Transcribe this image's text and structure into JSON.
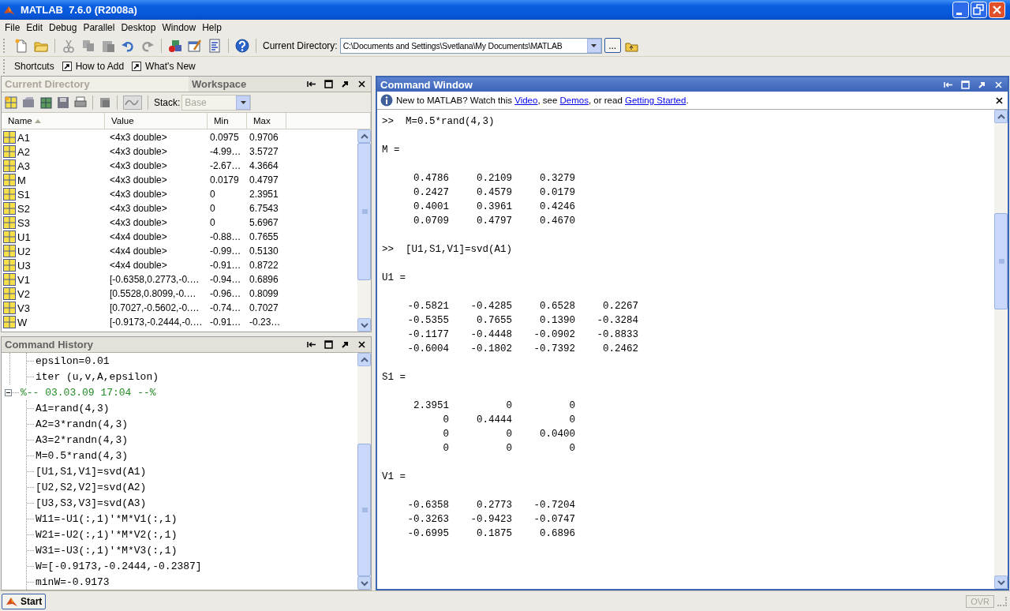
{
  "window": {
    "title": "MATLAB  7.6.0 (R2008a)"
  },
  "menu": [
    "File",
    "Edit",
    "Debug",
    "Parallel",
    "Desktop",
    "Window",
    "Help"
  ],
  "toolbar": {
    "directory_label": "Current Directory:",
    "directory_value": "C:\\Documents and Settings\\Svetlana\\My Documents\\MATLAB",
    "browse_button": "..."
  },
  "shortcuts": [
    {
      "label": "Shortcuts",
      "kind": "label"
    },
    {
      "label": "How to Add",
      "kind": "shortcut"
    },
    {
      "label": "What's New",
      "kind": "shortcut"
    }
  ],
  "left_tabs": [
    {
      "label": "Current Directory",
      "selected": false
    },
    {
      "label": "Workspace",
      "selected": true
    }
  ],
  "workspace": {
    "stack_label": "Stack:",
    "stack_value": "Base",
    "stack_disabled": true,
    "columns": [
      {
        "label": "Name",
        "sorted": true
      },
      {
        "label": "Value",
        "sorted": false
      },
      {
        "label": "Min",
        "sorted": false
      },
      {
        "label": "Max",
        "sorted": false
      }
    ],
    "rows": [
      {
        "name": "A1",
        "value": "<4x3 double>",
        "min": "0.0975",
        "max": "0.9706"
      },
      {
        "name": "A2",
        "value": "<4x3 double>",
        "min": "-4.99…",
        "max": "3.5727"
      },
      {
        "name": "A3",
        "value": "<4x3 double>",
        "min": "-2.67…",
        "max": "4.3664"
      },
      {
        "name": "M",
        "value": "<4x3 double>",
        "min": "0.0179",
        "max": "0.4797"
      },
      {
        "name": "S1",
        "value": "<4x3 double>",
        "min": "0",
        "max": "2.3951"
      },
      {
        "name": "S2",
        "value": "<4x3 double>",
        "min": "0",
        "max": "6.7543"
      },
      {
        "name": "S3",
        "value": "<4x3 double>",
        "min": "0",
        "max": "5.6967"
      },
      {
        "name": "U1",
        "value": "<4x4 double>",
        "min": "-0.88…",
        "max": "0.7655"
      },
      {
        "name": "U2",
        "value": "<4x4 double>",
        "min": "-0.99…",
        "max": "0.5130"
      },
      {
        "name": "U3",
        "value": "<4x4 double>",
        "min": "-0.91…",
        "max": "0.8722"
      },
      {
        "name": "V1",
        "value": "[-0.6358,0.2773,-0.…",
        "min": "-0.94…",
        "max": "0.6896"
      },
      {
        "name": "V2",
        "value": "[0.5528,0.8099,-0.…",
        "min": "-0.96…",
        "max": "0.8099"
      },
      {
        "name": "V3",
        "value": "[0.7027,-0.5602,-0.…",
        "min": "-0.74…",
        "max": "0.7027"
      },
      {
        "name": "W",
        "value": "[-0.9173,-0.2444,-0.…",
        "min": "-0.91…",
        "max": "-0.23…"
      }
    ]
  },
  "command_history": {
    "title": "Command History",
    "sessions": [
      {
        "children": [
          "epsilon=0.01",
          "iter (u,v,A,epsilon)"
        ]
      },
      {
        "header": "%-- 03.03.09 17:04 --%",
        "expanded": true,
        "children": [
          "A1=rand(4,3)",
          "A2=3*randn(4,3)",
          "A3=2*randn(4,3)",
          "M=0.5*rand(4,3)",
          "[U1,S1,V1]=svd(A1)",
          "[U2,S2,V2]=svd(A2)",
          "[U3,S3,V3]=svd(A3)",
          "W11=-U1(:,1)'*M*V1(:,1)",
          "W21=-U2(:,1)'*M*V2(:,1)",
          "W31=-U3(:,1)'*M*V3(:,1)",
          "W=[-0.9173,-0.2444,-0.2387]",
          "minW=-0.9173"
        ]
      }
    ]
  },
  "command_window": {
    "title": "Command Window",
    "info": [
      {
        "text": "New to MATLAB? Watch this ",
        "link": false
      },
      {
        "text": "Video",
        "link": true
      },
      {
        "text": ", see ",
        "link": false
      },
      {
        "text": "Demos",
        "link": true
      },
      {
        "text": ", or read ",
        "link": false
      },
      {
        "text": "Getting Started",
        "link": true
      },
      {
        "text": ".",
        "link": false
      }
    ],
    "entries": [
      {
        "kind": "command",
        "text": ">>  M=0.5*rand(4,3)"
      },
      {
        "kind": "matrix",
        "name": "M =",
        "rows": [
          [
            "0.4786",
            "0.2109",
            "0.3279"
          ],
          [
            "0.2427",
            "0.4579",
            "0.0179"
          ],
          [
            "0.4001",
            "0.3961",
            "0.4246"
          ],
          [
            "0.0709",
            "0.4797",
            "0.4670"
          ]
        ]
      },
      {
        "kind": "command",
        "text": ">>  [U1,S1,V1]=svd(A1)"
      },
      {
        "kind": "matrix",
        "name": "U1 =",
        "rows": [
          [
            "-0.5821",
            "-0.4285",
            "0.6528",
            "0.2267"
          ],
          [
            "-0.5355",
            "0.7655",
            "0.1390",
            "-0.3284"
          ],
          [
            "-0.1177",
            "-0.4448",
            "-0.0902",
            "-0.8833"
          ],
          [
            "-0.6004",
            "-0.1802",
            "-0.7392",
            "0.2462"
          ]
        ]
      },
      {
        "kind": "matrix",
        "name": "S1 =",
        "rows": [
          [
            "2.3951",
            "0",
            "0"
          ],
          [
            "0",
            "0.4444",
            "0"
          ],
          [
            "0",
            "0",
            "0.0400"
          ],
          [
            "0",
            "0",
            "0"
          ]
        ]
      },
      {
        "kind": "matrix",
        "name": "V1 =",
        "rows": [
          [
            "-0.6358",
            "0.2773",
            "-0.7204"
          ],
          [
            "-0.3263",
            "-0.9423",
            "-0.0747"
          ],
          [
            "-0.6995",
            "0.1875",
            "0.6896"
          ]
        ]
      }
    ]
  },
  "status_bar": {
    "start": "Start",
    "indicator": "OVR",
    "indicator_active": false
  }
}
